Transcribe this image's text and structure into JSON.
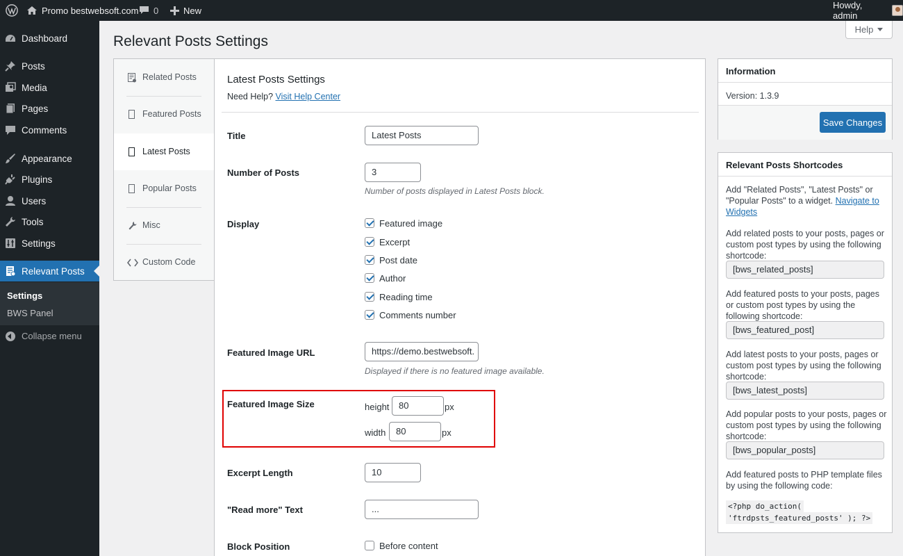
{
  "admin_bar": {
    "site_name": "Promo bestwebsoft.com",
    "comments_count": "0",
    "new_label": "New",
    "greeting": "Howdy, admin"
  },
  "sidebar": {
    "items": [
      {
        "label": "Dashboard",
        "icon": "dashboard-icon"
      },
      {
        "label": "Posts",
        "icon": "pin-icon"
      },
      {
        "label": "Media",
        "icon": "media-icon"
      },
      {
        "label": "Pages",
        "icon": "pages-icon"
      },
      {
        "label": "Comments",
        "icon": "comment-icon"
      },
      {
        "label": "Appearance",
        "icon": "brush-icon"
      },
      {
        "label": "Plugins",
        "icon": "plug-icon"
      },
      {
        "label": "Users",
        "icon": "user-icon"
      },
      {
        "label": "Tools",
        "icon": "wrench-icon"
      },
      {
        "label": "Settings",
        "icon": "settings-icon"
      },
      {
        "label": "Relevant Posts",
        "icon": "relevant-posts-icon"
      }
    ],
    "submenu": [
      "Settings",
      "BWS Panel"
    ],
    "collapse_label": "Collapse menu"
  },
  "help_label": "Help",
  "page_title": "Relevant Posts Settings",
  "tabs": [
    {
      "label": "Related Posts",
      "icon": "related-posts-icon"
    },
    {
      "label": "Featured Posts",
      "icon": "page-icon"
    },
    {
      "label": "Latest Posts",
      "icon": "page-icon"
    },
    {
      "label": "Popular Posts",
      "icon": "page-icon"
    },
    {
      "label": "Misc",
      "icon": "wrench-icon"
    },
    {
      "label": "Custom Code",
      "icon": "code-icon"
    }
  ],
  "settings": {
    "heading": "Latest Posts Settings",
    "need_help": "Need Help?",
    "help_link": "Visit Help Center",
    "title_label": "Title",
    "title_value": "Latest Posts",
    "num_label": "Number of Posts",
    "num_value": "3",
    "num_desc": "Number of posts displayed in Latest Posts block.",
    "display_label": "Display",
    "display_options": [
      {
        "label": "Featured image",
        "checked": true
      },
      {
        "label": "Excerpt",
        "checked": true
      },
      {
        "label": "Post date",
        "checked": true
      },
      {
        "label": "Author",
        "checked": true
      },
      {
        "label": "Reading time",
        "checked": true
      },
      {
        "label": "Comments number",
        "checked": true
      }
    ],
    "url_label": "Featured Image URL",
    "url_value": "https://demo.bestwebsoft.",
    "url_desc": "Displayed if there is no featured image available.",
    "size_label": "Featured Image Size",
    "height_label": "height",
    "height_value": "80",
    "width_label": "width",
    "width_value": "80",
    "px": "px",
    "excerpt_label": "Excerpt Length",
    "excerpt_value": "10",
    "readmore_label": "\"Read more\" Text",
    "readmore_value": "...",
    "position_label": "Block Position",
    "position_option": "Before content"
  },
  "info": {
    "title": "Information",
    "version": "Version: 1.3.9",
    "save_label": "Save Changes"
  },
  "shortcodes": {
    "title": "Relevant Posts Shortcodes",
    "intro_1": "Add \"Related Posts\", \"Latest Posts\" or \"Popular Posts\" to a widget.",
    "intro_link": "Navigate to Widgets",
    "related_text": "Add related posts to your posts, pages or custom post types by using the following shortcode:",
    "related_code": "[bws_related_posts]",
    "featured_text": "Add featured posts to your posts, pages or custom post types by using the following shortcode:",
    "featured_code": "[bws_featured_post]",
    "latest_text": "Add latest posts to your posts, pages or custom post types by using the following shortcode:",
    "latest_code": "[bws_latest_posts]",
    "popular_text": "Add popular posts to your posts, pages or custom post types by using the following shortcode:",
    "popular_code": "[bws_popular_posts]",
    "php_text": "Add featured posts to PHP template files by using the following code:",
    "php_line1": "<?php do_action(",
    "php_line2": "'ftrdpsts_featured_posts' ); ?>"
  }
}
